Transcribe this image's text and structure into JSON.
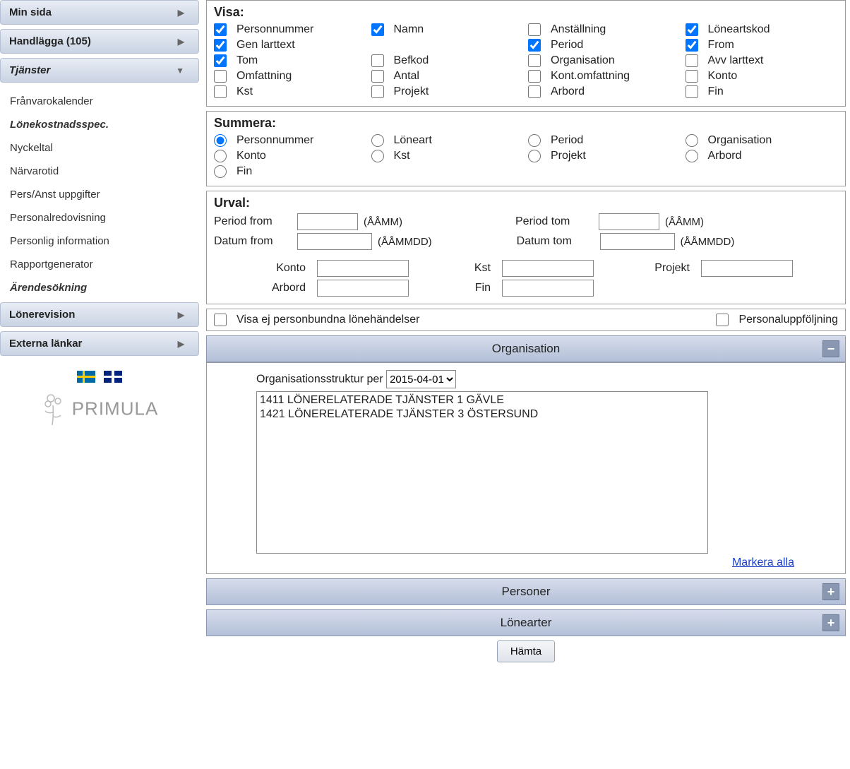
{
  "sidebar": {
    "items": [
      {
        "label": "Min sida",
        "type": "header",
        "arrow": "right"
      },
      {
        "label": "Handlägga (105)",
        "type": "header",
        "arrow": "right"
      },
      {
        "label": "Tjänster",
        "type": "header",
        "arrow": "down",
        "expanded": true
      },
      {
        "label": "Frånvarokalender",
        "type": "sub"
      },
      {
        "label": "Lönekostnadsspec.",
        "type": "sub",
        "active": true
      },
      {
        "label": "Nyckeltal",
        "type": "sub"
      },
      {
        "label": "Närvarotid",
        "type": "sub"
      },
      {
        "label": "Pers/Anst uppgifter",
        "type": "sub"
      },
      {
        "label": "Personalredovisning",
        "type": "sub"
      },
      {
        "label": "Personlig information",
        "type": "sub"
      },
      {
        "label": "Rapportgenerator",
        "type": "sub"
      },
      {
        "label": "Ärendesökning",
        "type": "sub",
        "active": true
      },
      {
        "label": "Lönerevision",
        "type": "header",
        "arrow": "right"
      },
      {
        "label": "Externa länkar",
        "type": "header",
        "arrow": "right"
      }
    ],
    "logo": "PRIMULA"
  },
  "visa": {
    "title": "Visa:",
    "items": [
      {
        "label": "Personnummer",
        "checked": true
      },
      {
        "label": "Namn",
        "checked": true
      },
      {
        "label": "Anställning",
        "checked": false
      },
      {
        "label": "Löneartskod",
        "checked": true
      },
      {
        "label": "Gen larttext",
        "checked": true
      },
      {
        "label": "",
        "checked": null
      },
      {
        "label": "Period",
        "checked": true
      },
      {
        "label": "From",
        "checked": true
      },
      {
        "label": "Tom",
        "checked": true
      },
      {
        "label": "Befkod",
        "checked": false
      },
      {
        "label": "Organisation",
        "checked": false
      },
      {
        "label": "Avv larttext",
        "checked": false
      },
      {
        "label": "Omfattning",
        "checked": false
      },
      {
        "label": "Antal",
        "checked": false
      },
      {
        "label": "Kont.omfattning",
        "checked": false
      },
      {
        "label": "Konto",
        "checked": false
      },
      {
        "label": "Kst",
        "checked": false
      },
      {
        "label": "Projekt",
        "checked": false
      },
      {
        "label": "Arbord",
        "checked": false
      },
      {
        "label": "Fin",
        "checked": false
      }
    ]
  },
  "summera": {
    "title": "Summera:",
    "items": [
      {
        "label": "Personnummer",
        "selected": true
      },
      {
        "label": "Löneart",
        "selected": false
      },
      {
        "label": "Period",
        "selected": false
      },
      {
        "label": "Organisation",
        "selected": false
      },
      {
        "label": "Konto",
        "selected": false
      },
      {
        "label": "Kst",
        "selected": false
      },
      {
        "label": "Projekt",
        "selected": false
      },
      {
        "label": "Arbord",
        "selected": false
      },
      {
        "label": "Fin",
        "selected": false
      }
    ]
  },
  "urval": {
    "title": "Urval:",
    "period_from_label": "Period from",
    "period_tom_label": "Period tom",
    "datum_from_label": "Datum from",
    "datum_tom_label": "Datum tom",
    "hint_aamm": "(ÅÅMM)",
    "hint_aammdd": "(ÅÅMMDD)",
    "konto_label": "Konto",
    "kst_label": "Kst",
    "projekt_label": "Projekt",
    "arbord_label": "Arbord",
    "fin_label": "Fin"
  },
  "extra": {
    "visa_ej_label": "Visa ej personbundna lönehändelser",
    "personalupp_label": "Personaluppföljning"
  },
  "org": {
    "header": "Organisation",
    "struct_label": "Organisationsstruktur per",
    "struct_date": "2015-04-01",
    "list": [
      "1411 LÖNERELATERADE TJÄNSTER 1 GÄVLE",
      "1421 LÖNERELATERADE TJÄNSTER 3 ÖSTERSUND"
    ],
    "mark_all": "Markera alla"
  },
  "personer_header": "Personer",
  "lonearter_header": "Lönearter",
  "fetch_label": "Hämta"
}
